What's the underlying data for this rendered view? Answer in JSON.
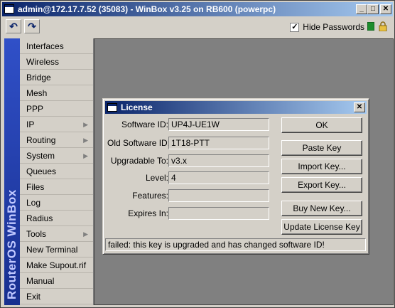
{
  "window": {
    "title": "admin@172.17.7.52 (35083) - WinBox v3.25 on RB600 (powerpc)",
    "controls": {
      "minimize": "_",
      "maximize": "□",
      "close": "✕"
    }
  },
  "toolbar": {
    "undo_icon": "↶",
    "redo_icon": "↷",
    "hide_passwords_label": "Hide Passwords",
    "hide_passwords_checked": "✓"
  },
  "sidebar": {
    "brand": "RouterOS WinBox",
    "items": [
      {
        "label": "Interfaces",
        "submenu": false
      },
      {
        "label": "Wireless",
        "submenu": false
      },
      {
        "label": "Bridge",
        "submenu": false
      },
      {
        "label": "Mesh",
        "submenu": false
      },
      {
        "label": "PPP",
        "submenu": false
      },
      {
        "label": "IP",
        "submenu": true
      },
      {
        "label": "Routing",
        "submenu": true
      },
      {
        "label": "System",
        "submenu": true
      },
      {
        "label": "Queues",
        "submenu": false
      },
      {
        "label": "Files",
        "submenu": false
      },
      {
        "label": "Log",
        "submenu": false
      },
      {
        "label": "Radius",
        "submenu": false
      },
      {
        "label": "Tools",
        "submenu": true
      },
      {
        "label": "New Terminal",
        "submenu": false
      },
      {
        "label": "Make Supout.rif",
        "submenu": false
      },
      {
        "label": "Manual",
        "submenu": false
      },
      {
        "label": "Exit",
        "submenu": false
      }
    ]
  },
  "license_dialog": {
    "title": "License",
    "close": "✕",
    "fields": {
      "software_id_label": "Software ID:",
      "software_id": "UP4J-UE1W",
      "old_software_id_label": "Old Software ID:",
      "old_software_id": "1T18-PTT",
      "upgradable_to_label": "Upgradable To:",
      "upgradable_to": "v3.x",
      "level_label": "Level:",
      "level": "4",
      "features_label": "Features:",
      "features": "",
      "expires_in_label": "Expires In:",
      "expires_in": ""
    },
    "buttons": {
      "ok": "OK",
      "paste_key": "Paste Key",
      "import_key": "Import Key...",
      "export_key": "Export Key...",
      "buy_new_key": "Buy New Key...",
      "update_license_key": "Update License Key"
    },
    "status": "failed: this key is upgraded and has changed software ID!"
  },
  "colors": {
    "title_active": "#0a246a",
    "face": "#d4d0c8",
    "workspace": "#808080",
    "brand_band": "#2a45b8"
  }
}
